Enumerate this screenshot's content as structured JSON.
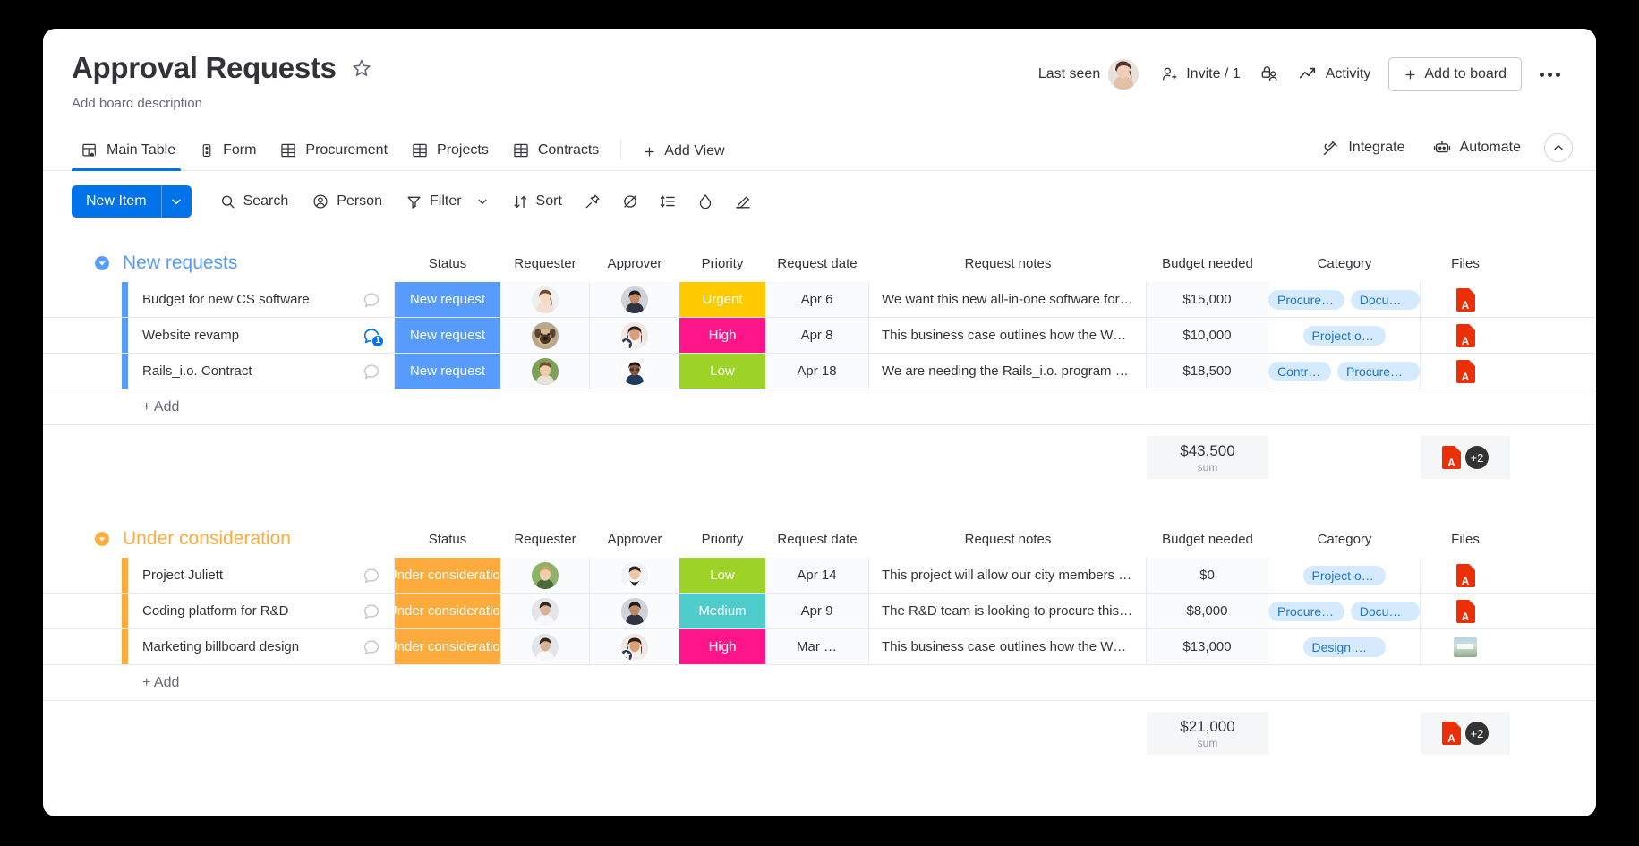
{
  "header": {
    "title": "Approval Requests",
    "description": "Add board description",
    "last_seen_label": "Last seen",
    "invite_label": "Invite / 1",
    "activity_label": "Activity",
    "add_to_board_label": "Add to board",
    "star_icon": "star-icon",
    "permissions_icon": "board-permissions-icon",
    "more_icon": "more-options-icon"
  },
  "tabs": {
    "items": [
      {
        "label": "Main Table",
        "icon": "main-table-icon",
        "active": true
      },
      {
        "label": "Form",
        "icon": "form-icon",
        "active": false
      },
      {
        "label": "Procurement",
        "icon": "table-icon",
        "active": false
      },
      {
        "label": "Projects",
        "icon": "table-icon",
        "active": false
      },
      {
        "label": "Contracts",
        "icon": "table-icon",
        "active": false
      }
    ],
    "add_view_label": "Add View",
    "integrate_label": "Integrate",
    "automate_label": "Automate",
    "collapse_icon": "chevron-up-icon"
  },
  "toolbar": {
    "new_item_label": "New Item",
    "search_label": "Search",
    "person_label": "Person",
    "filter_label": "Filter",
    "sort_label": "Sort",
    "icons": [
      "pin-icon",
      "hide-icon",
      "row-height-icon",
      "color-icon",
      "edit-icon"
    ]
  },
  "columns": [
    "Status",
    "Requester",
    "Approver",
    "Priority",
    "Request date",
    "Request notes",
    "Budget needed",
    "Category",
    "Files"
  ],
  "colors": {
    "accent": "#0073ea",
    "group_new_requests": "#579bfc",
    "group_under_consideration": "#fdab3d",
    "status_new_request": "#579bfc",
    "status_under_consideration": "#fdab3d",
    "priority_urgent": "#ffcb00",
    "priority_high": "#ff158a",
    "priority_medium": "#4ecccc",
    "priority_low": "#9cd326",
    "tag_bg": "#d6eaff",
    "tag_text": "#1f76c2",
    "pdf_red": "#eb2f06"
  },
  "groups": [
    {
      "name": "New requests",
      "color": "#579bfc",
      "add_label": "+ Add",
      "sum": {
        "value": "$43,500",
        "label": "sum"
      },
      "files_summary": {
        "badge": "+2",
        "icon": "pdf-icon"
      },
      "rows": [
        {
          "name": "Budget for new CS software",
          "comments": "",
          "status": "New request",
          "status_color": "#579bfc",
          "requester": "avatar-woman-1",
          "approver": "avatar-woman-2",
          "approver_badge": false,
          "priority": "Urgent",
          "priority_color": "#ffcb00",
          "date": "Apr 6",
          "notes": "We want this new all-in-one software for all…",
          "budget": "$15,000",
          "tags": [
            "Procurem…",
            "Docume…"
          ],
          "file": "pdf-icon"
        },
        {
          "name": "Website revamp",
          "comments": "1",
          "status": "New request",
          "status_color": "#579bfc",
          "requester": "avatar-dog",
          "approver": "avatar-woman-3",
          "approver_badge": true,
          "priority": "High",
          "priority_color": "#ff158a",
          "date": "Apr 8",
          "notes": "This business case outlines how the Web …",
          "budget": "$10,000",
          "tags": [
            "Project outline"
          ],
          "file": "pdf-icon"
        },
        {
          "name": "Rails_i.o. Contract",
          "comments": "",
          "status": "New request",
          "status_color": "#579bfc",
          "requester": "avatar-man-1",
          "approver": "avatar-woman-4",
          "approver_badge": false,
          "priority": "Low",
          "priority_color": "#9cd326",
          "date": "Apr 18",
          "notes": "We are needing the Rails_i.o. program by Q…",
          "budget": "$18,500",
          "tags": [
            "Contract",
            "Procurement"
          ],
          "file": "pdf-icon"
        }
      ]
    },
    {
      "name": "Under consideration",
      "color": "#fdab3d",
      "add_label": "+ Add",
      "sum": {
        "value": "$21,000",
        "label": "sum"
      },
      "files_summary": {
        "badge": "+2",
        "icon": "pdf-icon"
      },
      "rows": [
        {
          "name": "Project Juliett",
          "comments": "",
          "status": "Under consideration",
          "status_color": "#fdab3d",
          "requester": "avatar-man-2",
          "approver": "avatar-man-3",
          "approver_badge": false,
          "priority": "Low",
          "priority_color": "#9cd326",
          "date": "Apr 14",
          "notes": "This project will allow our city members to …",
          "budget": "$0",
          "tags": [
            "Project outline"
          ],
          "file": "pdf-icon"
        },
        {
          "name": "Coding platform for R&D",
          "comments": "",
          "status": "Under consideration",
          "status_color": "#fdab3d",
          "requester": "avatar-person-1",
          "approver": "avatar-woman-2",
          "approver_badge": false,
          "priority": "Medium",
          "priority_color": "#4ecccc",
          "date": "Apr 9",
          "notes": "The R&D team is looking to procure this co…",
          "budget": "$8,000",
          "tags": [
            "Procurem…",
            "Docume…"
          ],
          "file": "pdf-icon"
        },
        {
          "name": "Marketing billboard design",
          "comments": "",
          "status": "Under consideration",
          "status_color": "#fdab3d",
          "requester": "avatar-person-1",
          "approver": "avatar-woman-3",
          "approver_badge": true,
          "priority": "High",
          "priority_color": "#ff158a",
          "date": "Mar …",
          "notes": "This business case outlines how the Web …",
          "budget": "$13,000",
          "tags": [
            "Design mockup"
          ],
          "file": "image-thumb"
        }
      ]
    }
  ]
}
